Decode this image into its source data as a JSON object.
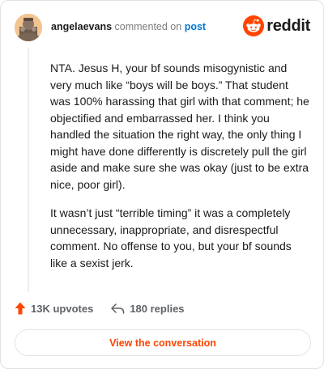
{
  "header": {
    "username": "angelaevans",
    "action": "commented on",
    "post_link": "post",
    "brand": "reddit"
  },
  "comment": {
    "paragraphs": [
      "NTA. Jesus H, your bf sounds misogynistic and very much like “boys will be boys.” That student was 100% harassing that girl with that comment; he objectified and embarrassed her. I think you handled the situation the right way, the only thing I might have done differently is discretely pull the girl aside and make sure she was okay (just to be extra nice, poor girl).",
      "It wasn’t just “terrible timing” it was a completely unnecessary, inappropriate, and disrespectful comment. No offense to you, but your bf sounds like a sexist jerk."
    ]
  },
  "footer": {
    "upvotes": "13K upvotes",
    "replies": "180 replies"
  },
  "cta": {
    "label": "View the conversation"
  },
  "colors": {
    "accent": "#ff4500",
    "link": "#0079d3"
  },
  "icons": {
    "avatar": "avatar",
    "logo": "reddit-snoo-icon",
    "upvote": "upvote-arrow-icon",
    "reply": "reply-arrow-icon"
  }
}
